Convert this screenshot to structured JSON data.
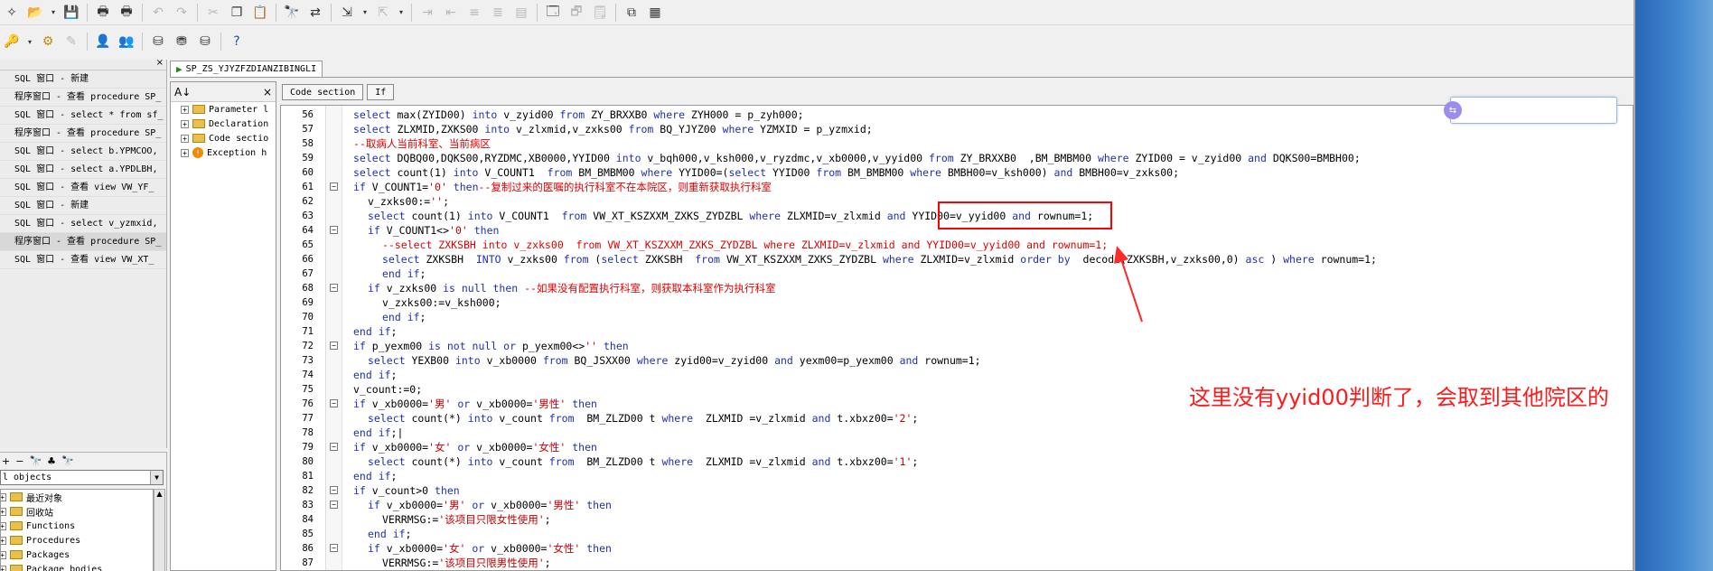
{
  "toolbar1": {
    "buttons": [
      "new-icon",
      "open-icon",
      "dropdown-arrow-icon",
      "save-icon",
      "print-icon",
      "print-preview-icon",
      "undo-icon",
      "redo-icon",
      "cut-icon",
      "copy-icon",
      "paste-icon",
      "find-icon",
      "replace-icon",
      "import-icon",
      "dropdown-arrow-icon",
      "export-icon",
      "dropdown-arrow-icon",
      "indent-icon",
      "unindent-icon",
      "comment-icon",
      "uncomment-icon",
      "toggle-icon",
      "window-list-icon",
      "object-icon",
      "report-icon",
      "tile-icon",
      "cascade-icon"
    ]
  },
  "toolbar2": {
    "buttons": [
      "key-icon",
      "dropdown-arrow-icon",
      "gear-icon",
      "wand-icon",
      "user-icon",
      "user-alt-icon",
      "session-icon",
      "db-icon",
      "db-alt-icon",
      "help-icon"
    ],
    "help_label": "?"
  },
  "window_list": {
    "close_label": "×",
    "items": [
      {
        "label": "SQL 窗口 - 新建",
        "selected": false
      },
      {
        "label": "程序窗口 - 查看 procedure SP_",
        "selected": false
      },
      {
        "label": "SQL 窗口 - select * from sf_",
        "selected": false
      },
      {
        "label": "程序窗口 - 查看 procedure SP_",
        "selected": false
      },
      {
        "label": "SQL 窗口 - select b.YPMCOO,",
        "selected": false
      },
      {
        "label": "SQL 窗口 - select a.YPDLBH,",
        "selected": false
      },
      {
        "label": "SQL 窗口 - 查看 view VW_YF_",
        "selected": false
      },
      {
        "label": "SQL 窗口 - 新建",
        "selected": false
      },
      {
        "label": "SQL 窗口 - select v_yzmxid,",
        "selected": false
      },
      {
        "label": "程序窗口 - 查看 procedure SP_",
        "selected": true
      },
      {
        "label": "SQL 窗口 - 查看 view VW_XT_",
        "selected": false
      }
    ]
  },
  "object_browser": {
    "toolbar": [
      "+",
      "−",
      "🔭",
      "♣",
      "🔭"
    ],
    "filter_value": "l objects",
    "tree": [
      {
        "label": "最近对象"
      },
      {
        "label": "回收站"
      },
      {
        "label": "Functions"
      },
      {
        "label": "Procedures"
      },
      {
        "label": "Packages"
      },
      {
        "label": "Package bodies"
      }
    ]
  },
  "editor": {
    "tab_title": "SP_ZS_YJYZFZDIANZIBINGLI",
    "tab_icon": "▶",
    "nav": {
      "sort_label": "A↓",
      "close_label": "×",
      "items": [
        {
          "label": "Parameter l",
          "type": "folder"
        },
        {
          "label": "Declaration",
          "type": "folder"
        },
        {
          "label": "Code sectio",
          "type": "folder"
        },
        {
          "label": "Exception h",
          "type": "exception"
        }
      ]
    },
    "breadcrumbs": [
      "Code section",
      "If"
    ],
    "code_lines": [
      {
        "n": "56",
        "fold": "",
        "segs": [
          [
            "kw",
            "select "
          ],
          [
            "",
            "max(ZYID00) "
          ],
          [
            "kw",
            "into "
          ],
          [
            "",
            "v_zyid00 "
          ],
          [
            "kw",
            "from "
          ],
          [
            "",
            "ZY_BRXXB0 "
          ],
          [
            "kw",
            "where "
          ],
          [
            "",
            "ZYH000 = p_zyh000;"
          ]
        ],
        "indent": 0
      },
      {
        "n": "57",
        "fold": "",
        "segs": [
          [
            "kw",
            "select "
          ],
          [
            "",
            "ZLXMID,ZXKS00 "
          ],
          [
            "kw",
            "into "
          ],
          [
            "",
            "v_zlxmid,v_zxks00 "
          ],
          [
            "kw",
            "from "
          ],
          [
            "",
            "BQ_YJYZ00 "
          ],
          [
            "kw",
            "where "
          ],
          [
            "",
            "YZMXID = p_yzmxid;"
          ]
        ],
        "indent": 0
      },
      {
        "n": "58",
        "fold": "",
        "segs": [
          [
            "cm",
            "--取病人当前科室、当前病区"
          ]
        ],
        "indent": 0
      },
      {
        "n": "59",
        "fold": "",
        "segs": [
          [
            "kw",
            "select "
          ],
          [
            "",
            "DQBQ00,DQKS00,RYZDMC,XB0000,YYID00 "
          ],
          [
            "kw",
            "into "
          ],
          [
            "",
            "v_bqh000,v_ksh000,v_ryzdmc,v_xb0000,v_yyid00 "
          ],
          [
            "kw",
            "from "
          ],
          [
            "",
            "ZY_BRXXB0  ,BM_BMBM00 "
          ],
          [
            "kw",
            "where "
          ],
          [
            "",
            "ZYID00 = v_zyid00 "
          ],
          [
            "kw",
            "and "
          ],
          [
            "",
            "DQKS00=BMBH00;"
          ]
        ],
        "indent": 0
      },
      {
        "n": "60",
        "fold": "",
        "segs": [
          [
            "kw",
            "select "
          ],
          [
            "",
            "count(1) "
          ],
          [
            "kw",
            "into "
          ],
          [
            "",
            "V_COUNT1  "
          ],
          [
            "kw",
            "from "
          ],
          [
            "",
            "BM_BMBM00 "
          ],
          [
            "kw",
            "where "
          ],
          [
            "",
            "YYID00=("
          ],
          [
            "kw",
            "select "
          ],
          [
            "",
            "YYID00 "
          ],
          [
            "kw",
            "from "
          ],
          [
            "",
            "BM_BMBM00 "
          ],
          [
            "kw",
            "where "
          ],
          [
            "",
            "BMBH00=v_ksh000) "
          ],
          [
            "kw",
            "and "
          ],
          [
            "",
            "BMBH00=v_zxks00;"
          ]
        ],
        "indent": 0
      },
      {
        "n": "61",
        "fold": "−",
        "segs": [
          [
            "kw",
            "if "
          ],
          [
            "",
            "V_COUNT1="
          ],
          [
            "str",
            "'0'"
          ],
          [
            "kw",
            " then"
          ],
          [
            "cm",
            "--复制过来的医嘱的执行科室不在本院区，则重新获取执行科室"
          ]
        ],
        "indent": 0
      },
      {
        "n": "62",
        "fold": "",
        "segs": [
          [
            "",
            "v_zxks00:="
          ],
          [
            "str",
            "''"
          ],
          [
            "",
            ";"
          ]
        ],
        "indent": 1
      },
      {
        "n": "63",
        "fold": "",
        "segs": [
          [
            "kw",
            "select "
          ],
          [
            "",
            "count(1) "
          ],
          [
            "kw",
            "into "
          ],
          [
            "",
            "V_COUNT1  "
          ],
          [
            "kw",
            "from "
          ],
          [
            "",
            "VW_XT_KSZXXM_ZXKS_ZYDZBL "
          ],
          [
            "kw",
            "where "
          ],
          [
            "",
            "ZLXMID=v_zlxmid "
          ],
          [
            "kw",
            "and "
          ],
          [
            "",
            "YYID00=v_yyid00 "
          ],
          [
            "kw",
            "and "
          ],
          [
            "",
            "rownum=1;"
          ]
        ],
        "indent": 1
      },
      {
        "n": "64",
        "fold": "−",
        "segs": [
          [
            "kw",
            "if "
          ],
          [
            "",
            "V_COUNT1<>"
          ],
          [
            "str",
            "'0'"
          ],
          [
            "kw",
            " then"
          ]
        ],
        "indent": 1
      },
      {
        "n": "65",
        "fold": "",
        "segs": [
          [
            "cm",
            "--select ZXKSBH into v_zxks00  from VW_XT_KSZXXM_ZXKS_ZYDZBL where ZLXMID=v_zlxmid and YYID00=v_yyid00 and rownum=1;"
          ]
        ],
        "indent": 2
      },
      {
        "n": "66",
        "fold": "",
        "segs": [
          [
            "kw",
            "select "
          ],
          [
            "",
            "ZXKSBH  "
          ],
          [
            "kw",
            "INTO "
          ],
          [
            "",
            "v_zxks00 "
          ],
          [
            "kw",
            "from "
          ],
          [
            "",
            "("
          ],
          [
            "kw",
            "select "
          ],
          [
            "",
            "ZXKSBH  "
          ],
          [
            "kw",
            "from "
          ],
          [
            "",
            "VW_XT_KSZXXM_ZXKS_ZYDZBL "
          ],
          [
            "kw",
            "where "
          ],
          [
            "",
            "ZLXMID=v_zlxmid "
          ],
          [
            "kw",
            "order by  "
          ],
          [
            "",
            "decode(ZXKSBH,v_zxks00,0) "
          ],
          [
            "kw",
            "asc"
          ],
          [
            "",
            " ) "
          ],
          [
            "kw",
            "where "
          ],
          [
            "",
            "rownum=1;"
          ]
        ],
        "indent": 2
      },
      {
        "n": "67",
        "fold": "",
        "segs": [
          [
            "kw",
            "end if"
          ],
          [
            "",
            ";"
          ]
        ],
        "indent": 2
      },
      {
        "n": "68",
        "fold": "−",
        "segs": [
          [
            "kw",
            "if "
          ],
          [
            "",
            "v_zxks00 "
          ],
          [
            "kw",
            "is null then "
          ],
          [
            "cm",
            "--如果没有配置执行科室，则获取本科室作为执行科室"
          ]
        ],
        "indent": 1
      },
      {
        "n": "69",
        "fold": "",
        "segs": [
          [
            "",
            "v_zxks00:=v_ksh000;"
          ]
        ],
        "indent": 2
      },
      {
        "n": "70",
        "fold": "",
        "segs": [
          [
            "kw",
            "end if"
          ],
          [
            "",
            ";"
          ]
        ],
        "indent": 2
      },
      {
        "n": "71",
        "fold": "",
        "segs": [
          [
            "kw",
            "end if"
          ],
          [
            "",
            ";"
          ]
        ],
        "indent": 0
      },
      {
        "n": "72",
        "fold": "−",
        "segs": [
          [
            "kw",
            "if "
          ],
          [
            "",
            "p_yexm00 "
          ],
          [
            "kw",
            "is not null or "
          ],
          [
            "",
            "p_yexm00<>"
          ],
          [
            "str",
            "''"
          ],
          [
            "kw",
            " then"
          ]
        ],
        "indent": 0
      },
      {
        "n": "73",
        "fold": "",
        "segs": [
          [
            "kw",
            "select "
          ],
          [
            "",
            "YEXB00 "
          ],
          [
            "kw",
            "into "
          ],
          [
            "",
            "v_xb0000 "
          ],
          [
            "kw",
            "from "
          ],
          [
            "",
            "BQ_JSXX00 "
          ],
          [
            "kw",
            "where "
          ],
          [
            "",
            "zyid00=v_zyid00 "
          ],
          [
            "kw",
            "and "
          ],
          [
            "",
            "yexm00=p_yexm00 "
          ],
          [
            "kw",
            "and "
          ],
          [
            "",
            "rownum=1;"
          ]
        ],
        "indent": 1
      },
      {
        "n": "74",
        "fold": "",
        "segs": [
          [
            "kw",
            "end if"
          ],
          [
            "",
            ";"
          ]
        ],
        "indent": 0
      },
      {
        "n": "75",
        "fold": "",
        "segs": [
          [
            "",
            "v_count:=0;"
          ]
        ],
        "indent": 0
      },
      {
        "n": "76",
        "fold": "−",
        "segs": [
          [
            "kw",
            "if "
          ],
          [
            "",
            "v_xb0000="
          ],
          [
            "str",
            "'男'"
          ],
          [
            "kw",
            " or "
          ],
          [
            "",
            "v_xb0000="
          ],
          [
            "str",
            "'男性'"
          ],
          [
            "kw",
            " then"
          ]
        ],
        "indent": 0
      },
      {
        "n": "77",
        "fold": "",
        "segs": [
          [
            "kw",
            "select "
          ],
          [
            "",
            "count(*) "
          ],
          [
            "kw",
            "into "
          ],
          [
            "",
            "v_count "
          ],
          [
            "kw",
            "from  "
          ],
          [
            "",
            "BM_ZLZD00 t "
          ],
          [
            "kw",
            "where  "
          ],
          [
            "",
            "ZLXMID =v_zlxmid "
          ],
          [
            "kw",
            "and "
          ],
          [
            "",
            "t.xbxz00="
          ],
          [
            "str",
            "'2'"
          ],
          [
            "",
            ";"
          ]
        ],
        "indent": 1
      },
      {
        "n": "78",
        "fold": "",
        "segs": [
          [
            "kw",
            "end if"
          ],
          [
            "",
            ";|"
          ]
        ],
        "indent": 0
      },
      {
        "n": "79",
        "fold": "−",
        "segs": [
          [
            "kw",
            "if "
          ],
          [
            "",
            "v_xb0000="
          ],
          [
            "str",
            "'女'"
          ],
          [
            "kw",
            " or "
          ],
          [
            "",
            "v_xb0000="
          ],
          [
            "str",
            "'女性'"
          ],
          [
            "kw",
            " then"
          ]
        ],
        "indent": 0
      },
      {
        "n": "80",
        "fold": "",
        "segs": [
          [
            "kw",
            "select "
          ],
          [
            "",
            "count(*) "
          ],
          [
            "kw",
            "into "
          ],
          [
            "",
            "v_count "
          ],
          [
            "kw",
            "from  "
          ],
          [
            "",
            "BM_ZLZD00 t "
          ],
          [
            "kw",
            "where  "
          ],
          [
            "",
            "ZLXMID =v_zlxmid "
          ],
          [
            "kw",
            "and "
          ],
          [
            "",
            "t.xbxz00="
          ],
          [
            "str",
            "'1'"
          ],
          [
            "",
            ";"
          ]
        ],
        "indent": 1
      },
      {
        "n": "81",
        "fold": "",
        "segs": [
          [
            "kw",
            "end if"
          ],
          [
            "",
            ";"
          ]
        ],
        "indent": 0
      },
      {
        "n": "82",
        "fold": "−",
        "segs": [
          [
            "kw",
            "if "
          ],
          [
            "",
            "v_count>0 "
          ],
          [
            "kw",
            "then"
          ]
        ],
        "indent": 0
      },
      {
        "n": "83",
        "fold": "−",
        "segs": [
          [
            "kw",
            "if "
          ],
          [
            "",
            "v_xb0000="
          ],
          [
            "str",
            "'男'"
          ],
          [
            "kw",
            " or "
          ],
          [
            "",
            "v_xb0000="
          ],
          [
            "str",
            "'男性'"
          ],
          [
            "kw",
            " then"
          ]
        ],
        "indent": 1
      },
      {
        "n": "84",
        "fold": "",
        "segs": [
          [
            "",
            "VERRMSG:="
          ],
          [
            "str",
            "'该项目只限女性使用'"
          ],
          [
            "",
            ";"
          ]
        ],
        "indent": 2
      },
      {
        "n": "85",
        "fold": "",
        "segs": [
          [
            "kw",
            "end if"
          ],
          [
            "",
            ";"
          ]
        ],
        "indent": 1
      },
      {
        "n": "86",
        "fold": "−",
        "segs": [
          [
            "kw",
            "if "
          ],
          [
            "",
            "v_xb0000="
          ],
          [
            "str",
            "'女'"
          ],
          [
            "kw",
            " or "
          ],
          [
            "",
            "v_xb0000="
          ],
          [
            "str",
            "'女性'"
          ],
          [
            "kw",
            " then"
          ]
        ],
        "indent": 1
      },
      {
        "n": "87",
        "fold": "",
        "segs": [
          [
            "",
            "VERRMSG:="
          ],
          [
            "str",
            "'该项目只限男性使用'"
          ],
          [
            "",
            ";"
          ]
        ],
        "indent": 2
      }
    ]
  },
  "annotation": {
    "text": "这里没有yyid00判断了，会取到其他院区的",
    "color": "#ff1a1a"
  },
  "search_popup": {
    "badge": "⇆"
  },
  "colors": {
    "keyword": "#1f2fb6",
    "comment": "#e00000",
    "string": "#c00000",
    "annotation": "#ff0000"
  }
}
